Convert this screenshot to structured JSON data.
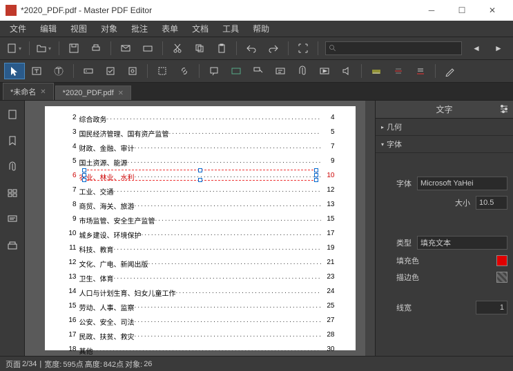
{
  "window": {
    "title": "*2020_PDF.pdf - Master PDF Editor"
  },
  "menu": {
    "file": "文件",
    "edit": "编辑",
    "view": "视图",
    "object": "对象",
    "annotate": "批注",
    "form": "表单",
    "document": "文档",
    "tool": "工具",
    "help": "帮助"
  },
  "tabs": [
    {
      "label": "*未命名",
      "active": false
    },
    {
      "label": "*2020_PDF.pdf",
      "active": true
    }
  ],
  "toc": {
    "selected_index": 5,
    "items": [
      {
        "num": "2",
        "txt": "综合政务",
        "pg": "4"
      },
      {
        "num": "3",
        "txt": "国民经济管理、国有资产监管",
        "pg": "5"
      },
      {
        "num": "4",
        "txt": "财政、金融、审计",
        "pg": "7"
      },
      {
        "num": "5",
        "txt": "国土资源、能源",
        "pg": "9"
      },
      {
        "num": "6",
        "txt": "农业、林业、水利",
        "pg": "10"
      },
      {
        "num": "7",
        "txt": "工业、交通",
        "pg": "12"
      },
      {
        "num": "8",
        "txt": "商贸、海关、旅游",
        "pg": "13"
      },
      {
        "num": "9",
        "txt": "市场监管、安全生产监管",
        "pg": "15"
      },
      {
        "num": "10",
        "txt": "城乡建设、环境保护",
        "pg": "17"
      },
      {
        "num": "11",
        "txt": "科技、教育",
        "pg": "19"
      },
      {
        "num": "12",
        "txt": "文化、广电、新闻出版",
        "pg": "21"
      },
      {
        "num": "13",
        "txt": "卫生、体育",
        "pg": "23"
      },
      {
        "num": "14",
        "txt": "人口与计划生育、妇女儿童工作",
        "pg": "24"
      },
      {
        "num": "15",
        "txt": "劳动、人事、监察",
        "pg": "25"
      },
      {
        "num": "16",
        "txt": "公安、安全、司法",
        "pg": "27"
      },
      {
        "num": "17",
        "txt": "民政、扶贫、救灾",
        "pg": "28"
      },
      {
        "num": "18",
        "txt": "其他",
        "pg": "30"
      }
    ]
  },
  "panel": {
    "title": "文字",
    "sec_geom": "几何",
    "sec_font": "字体",
    "font_label": "字体",
    "font_value": "Microsoft YaHei",
    "size_label": "大小",
    "size_value": "10.5",
    "type_label": "类型",
    "type_value": "填充文本",
    "fill_label": "填充色",
    "fill_color": "#e00000",
    "stroke_label": "描边色",
    "lw_label": "线宽",
    "lw_value": "1"
  },
  "status": {
    "page_label": "页面",
    "page_value": "2/34",
    "width_label": "宽度:",
    "width_value": "595点",
    "height_label": "高度:",
    "height_value": "842点",
    "obj_label": "对象:",
    "obj_value": "26"
  }
}
